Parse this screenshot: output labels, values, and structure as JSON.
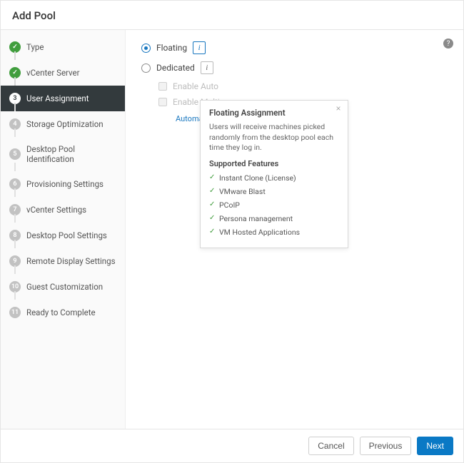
{
  "title": "Add Pool",
  "steps": [
    {
      "label": "Type",
      "state": "done"
    },
    {
      "label": "vCenter Server",
      "state": "done"
    },
    {
      "label": "User Assignment",
      "state": "active"
    },
    {
      "label": "Storage Optimization",
      "state": "num",
      "num": "4"
    },
    {
      "label": "Desktop Pool Identification",
      "state": "num",
      "num": "5"
    },
    {
      "label": "Provisioning Settings",
      "state": "num",
      "num": "6"
    },
    {
      "label": "vCenter Settings",
      "state": "num",
      "num": "7"
    },
    {
      "label": "Desktop Pool Settings",
      "state": "num",
      "num": "8"
    },
    {
      "label": "Remote Display Settings",
      "state": "num",
      "num": "9"
    },
    {
      "label": "Guest Customization",
      "state": "num",
      "num": "10"
    },
    {
      "label": "Ready to Complete",
      "state": "num",
      "num": "11"
    }
  ],
  "assignment": {
    "floating_label": "Floating",
    "dedicated_label": "Dedicated",
    "enable_auto_label": "Enable Auto",
    "enable_multi_label": "Enable Multi",
    "automatic_label": "Automatic as"
  },
  "info_btn": {
    "glyph": "i"
  },
  "help": {
    "glyph": "?"
  },
  "popover": {
    "title": "Floating Assignment",
    "body": "Users will receive machines picked randomly from the desktop pool each time they log in.",
    "features_heading": "Supported Features",
    "features": [
      "Instant Clone (License)",
      "VMware Blast",
      "PCoIP",
      "Persona management",
      "VM Hosted Applications"
    ],
    "close_glyph": "×"
  },
  "footer": {
    "cancel": "Cancel",
    "previous": "Previous",
    "next": "Next"
  }
}
